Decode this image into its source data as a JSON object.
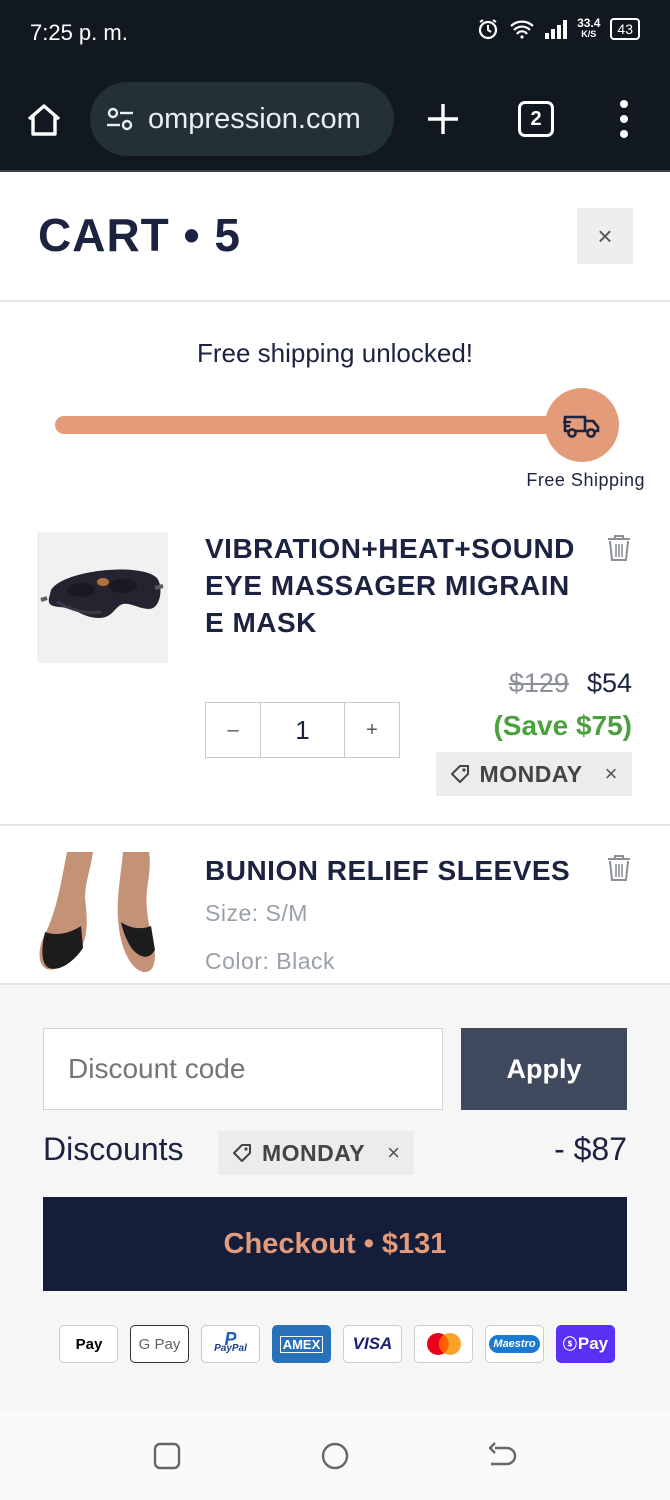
{
  "status": {
    "time": "7:25 p. m.",
    "speed_top": "33.4",
    "speed_bottom": "K/S",
    "battery": "43"
  },
  "browser": {
    "url": "ompression.com",
    "tab_count": "2"
  },
  "cart": {
    "title": "CART • 5",
    "close": "×"
  },
  "shipping": {
    "message": "Free shipping unlocked!",
    "label": "Free Shipping",
    "progress_percent": 100
  },
  "items": [
    {
      "title": "VIBRATION+HEAT+SOUND EYE MASSAGER MIGRAINE MASK",
      "old_price": "$129",
      "price": "$54",
      "save": "(Save $75)",
      "qty": "1",
      "qty_minus": "–",
      "qty_plus": "+",
      "discount_tag": "MONDAY",
      "discount_remove": "×"
    },
    {
      "title": "BUNION RELIEF SLEEVES",
      "size": "Size: S/M",
      "color": "Color: Black"
    }
  ],
  "footer": {
    "discount_placeholder": "Discount code",
    "apply": "Apply",
    "discounts_label": "Discounts",
    "discount_tag": "MONDAY",
    "discount_remove": "×",
    "discount_amount": "- $87",
    "checkout": "Checkout • $131",
    "payments": [
      "Pay",
      "G Pay",
      "PayPal",
      "AMEX",
      "VISA",
      "",
      "Maestro",
      "Pay"
    ]
  },
  "colors": {
    "accent": "#e39b7a",
    "navy": "#141d3a",
    "save_green": "#4aa23d",
    "apply_bg": "#3f4a5f"
  }
}
